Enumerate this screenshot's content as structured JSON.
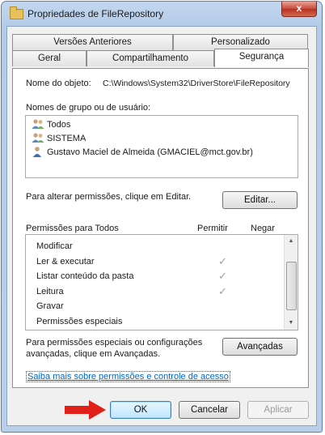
{
  "window": {
    "title": "Propriedades de FileRepository",
    "close_label": "x"
  },
  "tabs": {
    "row1": [
      "Versões Anteriores",
      "Personalizado"
    ],
    "row2": [
      "Geral",
      "Compartilhamento",
      "Segurança"
    ]
  },
  "object": {
    "label": "Nome do objeto:",
    "value": "C:\\Windows\\System32\\DriverStore\\FileRepository"
  },
  "groups": {
    "label": "Nomes de grupo ou de usuário:",
    "items": [
      "Todos",
      "SISTEMA",
      "Gustavo Maciel de Almeida (GMACIEL@mct.gov.br)"
    ]
  },
  "edit": {
    "text": "Para alterar permissões, clique em Editar.",
    "button": "Editar..."
  },
  "permissions": {
    "header": "Permissões para Todos",
    "col_allow": "Permitir",
    "col_deny": "Negar",
    "check_glyph": "✓",
    "rows": [
      {
        "name": "Modificar",
        "allow": false
      },
      {
        "name": "Ler & executar",
        "allow": true
      },
      {
        "name": "Listar conteúdo da pasta",
        "allow": true
      },
      {
        "name": "Leitura",
        "allow": true
      },
      {
        "name": "Gravar",
        "allow": false
      },
      {
        "name": "Permissões especiais",
        "allow": false
      }
    ]
  },
  "advanced": {
    "text_line1": "Para permissões especiais ou configurações",
    "text_line2": "avançadas, clique em Avançadas.",
    "button": "Avançadas"
  },
  "link": "Saiba mais sobre permissões e controle de acesso",
  "footer": {
    "ok": "OK",
    "cancel": "Cancelar",
    "apply": "Aplicar"
  },
  "colors": {
    "arrow": "#e0201a",
    "link": "#0066cc"
  }
}
